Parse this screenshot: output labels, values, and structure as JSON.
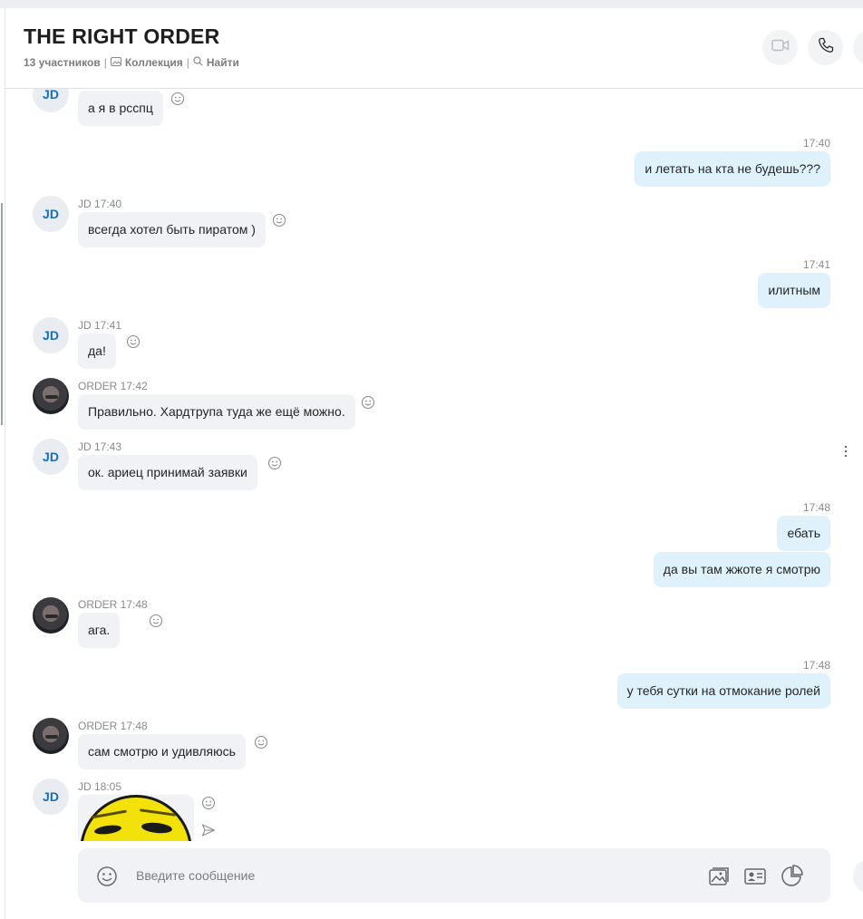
{
  "header": {
    "title": "THE RIGHT ORDER",
    "participants": "13 участников",
    "separator": "|",
    "collection": "Коллекция",
    "find": "Найти"
  },
  "icons": {
    "video": "video-camera-icon",
    "call": "phone-icon",
    "more": "more-icon",
    "gallery": "image-icon",
    "contact": "contact-card-icon",
    "poll": "poll-icon",
    "emoji": "smiley-icon",
    "send": "send-icon"
  },
  "messages": [
    {
      "dir": "in",
      "avatar": "JD",
      "meta": "",
      "text": "а я в рсспц"
    },
    {
      "dir": "out",
      "meta": "17:40",
      "text": "и летать на кта не будешь???"
    },
    {
      "dir": "in",
      "avatar": "JD",
      "meta": "JD 17:40",
      "text": "всегда хотел быть пиратом )"
    },
    {
      "dir": "out",
      "meta": "17:41",
      "text": "илитным"
    },
    {
      "dir": "in",
      "avatar": "JD",
      "meta": "JD 17:41",
      "text": "да!"
    },
    {
      "dir": "in",
      "avatar": "photo",
      "meta": "ORDER 17:42",
      "text": "Правильно. Хардтрупа туда же ещё можно."
    },
    {
      "dir": "in",
      "avatar": "JD",
      "meta": "JD 17:43",
      "text": "ок. ариец принимай заявки"
    },
    {
      "dir": "out",
      "meta": "17:48",
      "text": "ебать"
    },
    {
      "dir": "out",
      "meta": "",
      "text": "да вы там жжоте я смотрю"
    },
    {
      "dir": "in",
      "avatar": "photo",
      "meta": "ORDER 17:48",
      "text": "ага."
    },
    {
      "dir": "out",
      "meta": "17:48",
      "text": "у тебя сутки на отмокание ролей"
    },
    {
      "dir": "in",
      "avatar": "photo",
      "meta": "ORDER 17:48",
      "text": "сам смотрю и удивляюсь"
    },
    {
      "dir": "in",
      "avatar": "JD",
      "meta": "JD 18:05",
      "text": ""
    }
  ],
  "composer": {
    "placeholder": "Введите сообщение"
  }
}
